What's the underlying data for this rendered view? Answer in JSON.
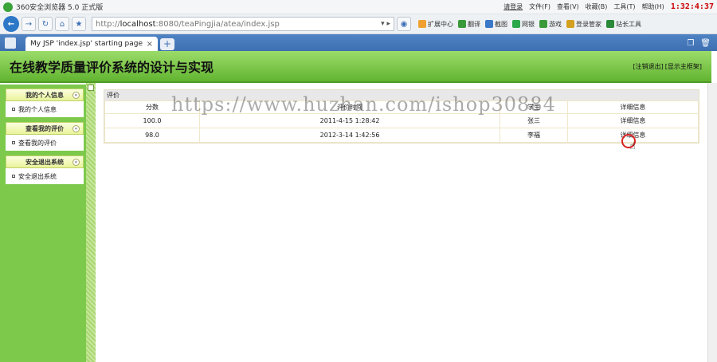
{
  "browser": {
    "title": "360安全浏览器 5.0 正式版",
    "login": "请登录",
    "menu": [
      "文件(F)",
      "查看(V)",
      "收藏(B)",
      "工具(T)",
      "帮助(H)"
    ],
    "clock": "1:32:4:37",
    "url_prefix": "http://",
    "url_host": "localhost",
    "url_rest": ":8080/teaPingjia/atea/index.jsp",
    "extensions": [
      "扩展中心",
      "翻译",
      "截图",
      "网银",
      "游戏",
      "登录管家",
      "站长工具"
    ],
    "tab_label": "My JSP 'index.jsp' starting page",
    "tab_close": "×",
    "new_tab": "+"
  },
  "app": {
    "title": "在线教学质量评价系统的设计与实现",
    "logout_link": "[注销退出]",
    "home_link": "[显示主框架]"
  },
  "menu": [
    {
      "header": "我的个人信息",
      "item": "我的个人信息"
    },
    {
      "header": "查看我的评价",
      "item": "查看我的评价"
    },
    {
      "header": "安全退出系统",
      "item": "安全退出系统"
    }
  ],
  "panel": {
    "title": "评价",
    "columns": [
      "分数",
      "评价时间",
      "学生",
      "详细信息"
    ],
    "rows": [
      {
        "score": "100.0",
        "time": "2011-4-15 1:28:42",
        "student": "张三",
        "detail": "详细信息"
      },
      {
        "score": "98.0",
        "time": "2012-3-14 1:42:56",
        "student": "李福",
        "detail": "详细信息"
      }
    ]
  },
  "watermark": "https://www.huzhan.com/ishop30884",
  "colors": {
    "header_green": "#62b431",
    "menu_green": "#7cc94b",
    "tab_blue": "#3d6fb1"
  }
}
